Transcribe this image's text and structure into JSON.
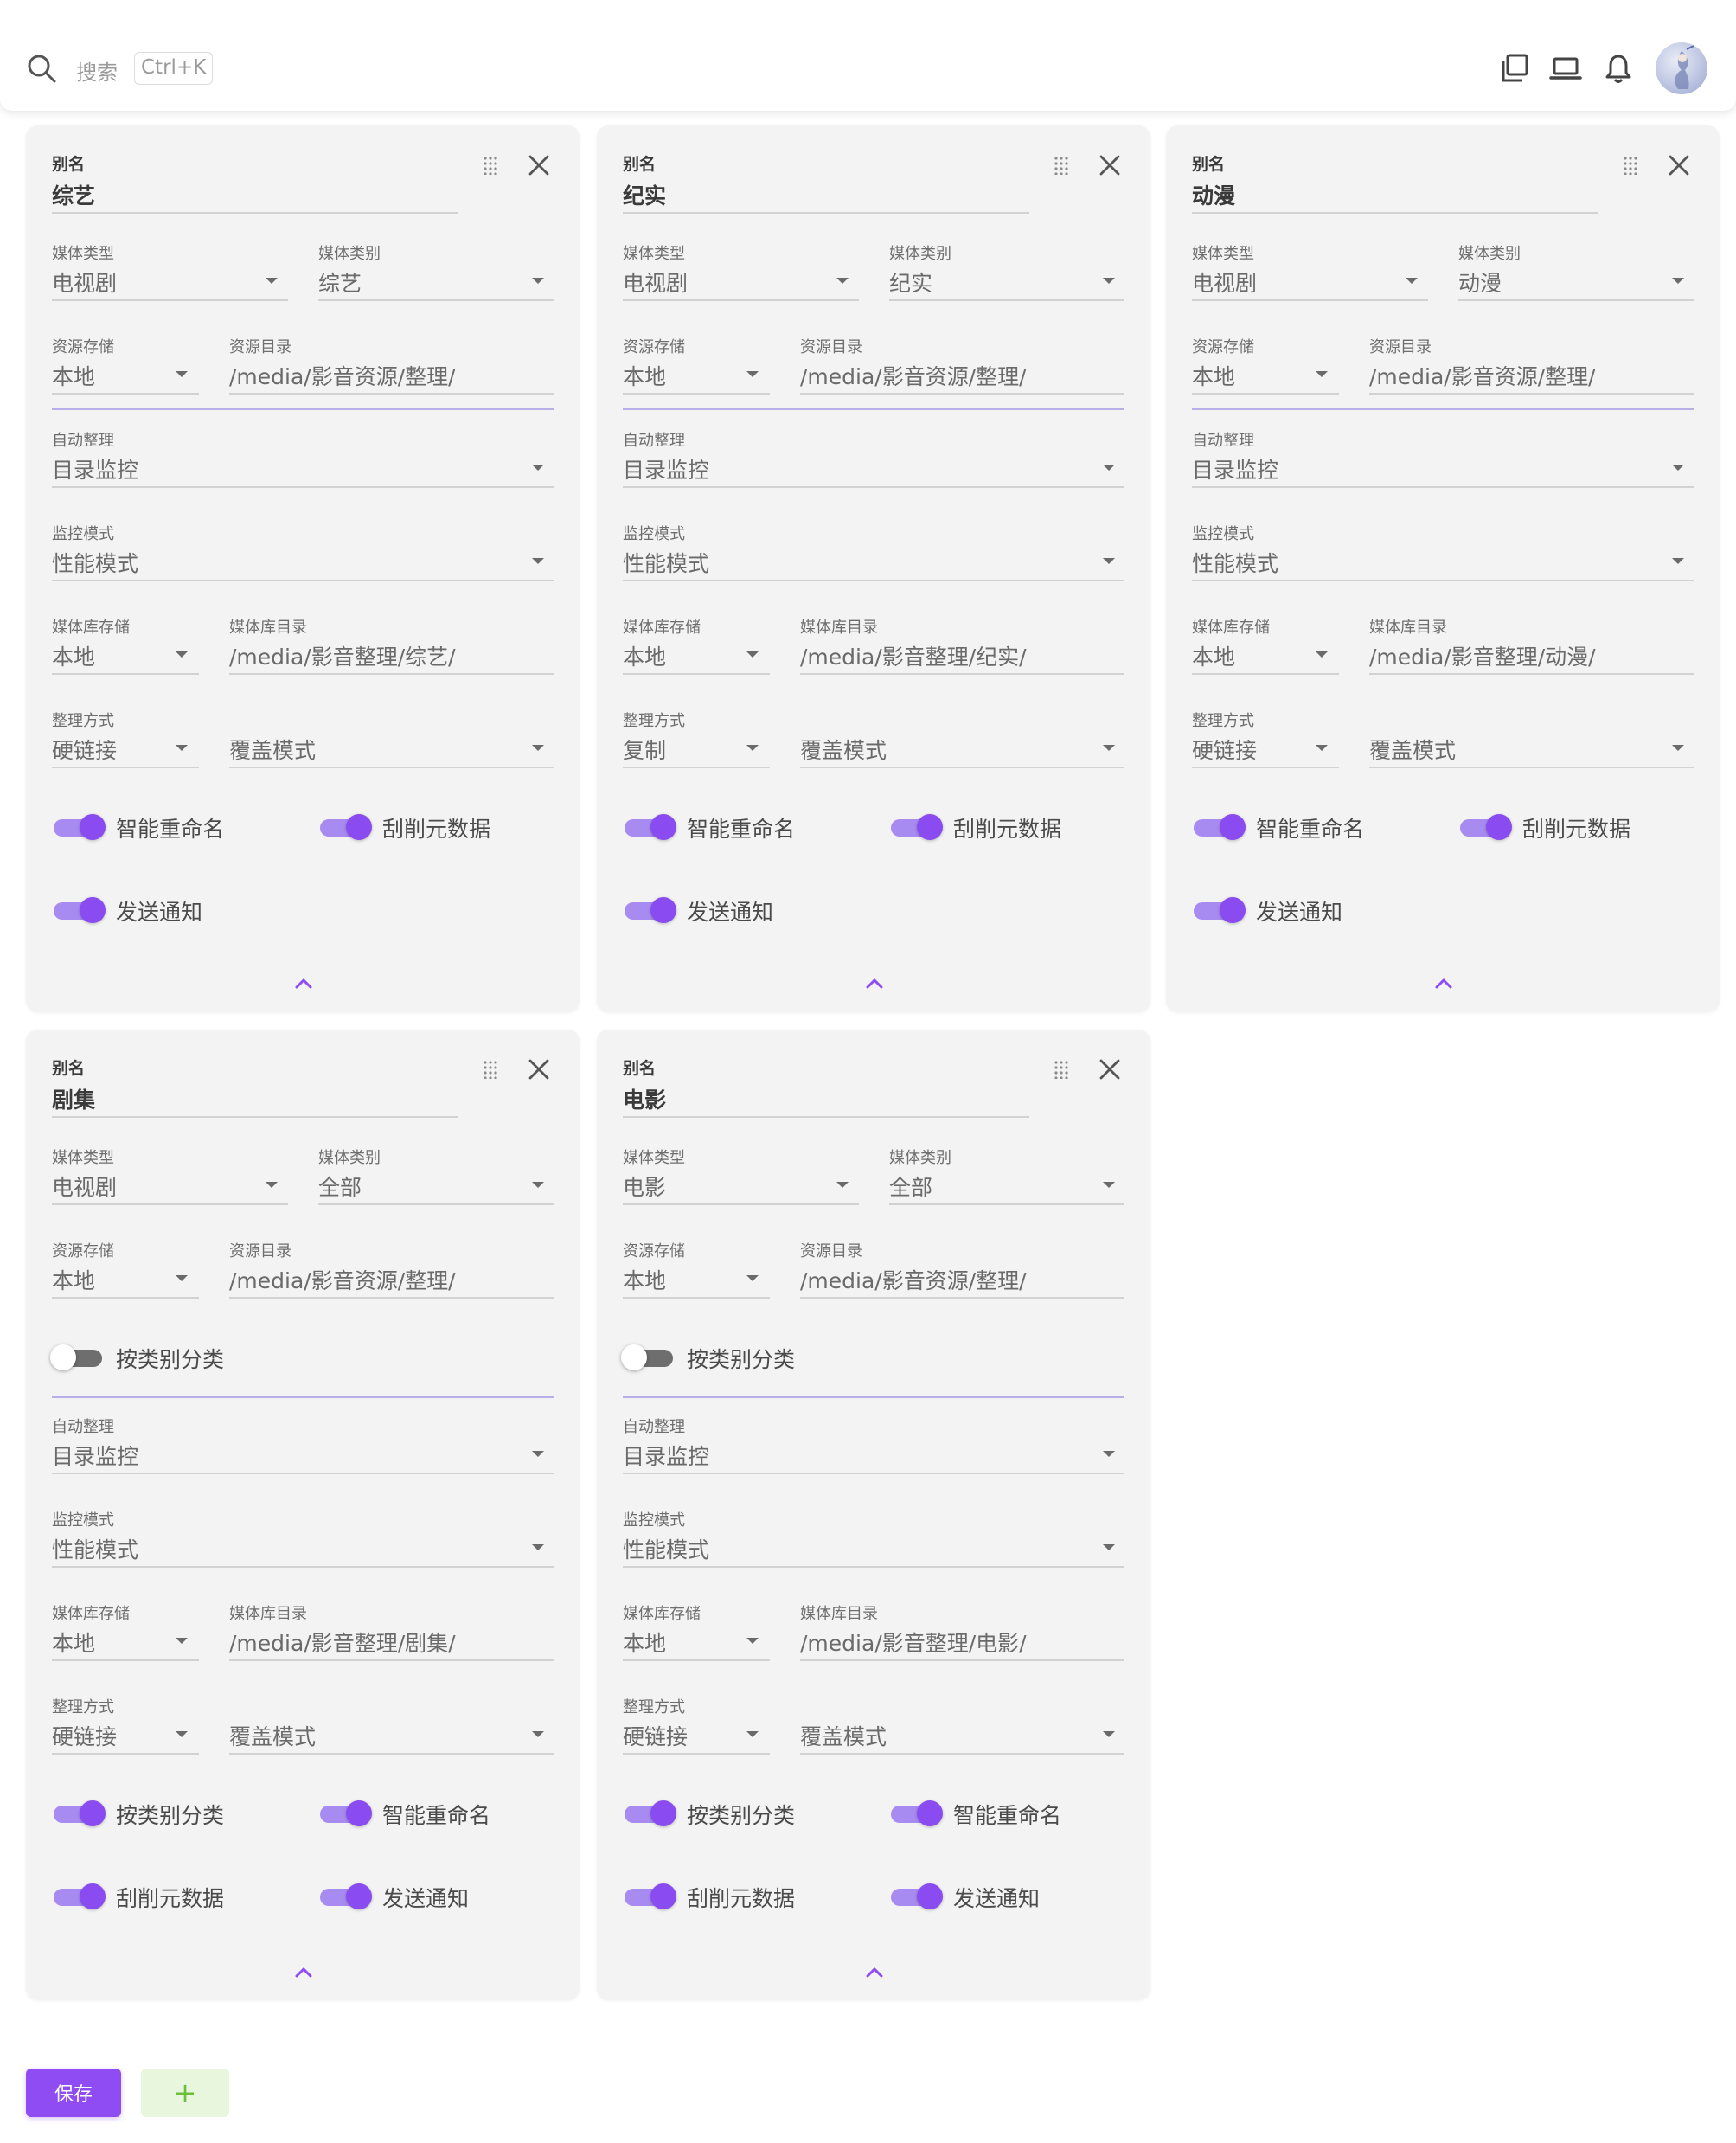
{
  "topbar": {
    "search_label": "搜索",
    "search_shortcut": "Ctrl+K"
  },
  "labels": {
    "alias": "别名",
    "media_type": "媒体类型",
    "media_category": "媒体类别",
    "source_storage": "资源存储",
    "source_dir": "资源目录",
    "auto_organize": "自动整理",
    "monitor_mode": "监控模式",
    "library_storage": "媒体库存储",
    "library_dir": "媒体库目录",
    "transfer_method": "整理方式"
  },
  "cards": [
    {
      "alias": "综艺",
      "media_type": "电视剧",
      "media_category": "综艺",
      "source_storage": "本地",
      "source_dir": "/media/影音资源/整理/",
      "auto_organize": "目录监控",
      "monitor_mode": "性能模式",
      "library_storage": "本地",
      "library_dir": "/media/影音整理/综艺/",
      "transfer_method": "硬链接",
      "overwrite_mode": "覆盖模式",
      "toggles": [
        {
          "label": "智能重命名",
          "on": true
        },
        {
          "label": "刮削元数据",
          "on": true
        },
        {
          "label": "发送通知",
          "on": true
        }
      ]
    },
    {
      "alias": "纪实",
      "media_type": "电视剧",
      "media_category": "纪实",
      "source_storage": "本地",
      "source_dir": "/media/影音资源/整理/",
      "auto_organize": "目录监控",
      "monitor_mode": "性能模式",
      "library_storage": "本地",
      "library_dir": "/media/影音整理/纪实/",
      "transfer_method": "复制",
      "overwrite_mode": "覆盖模式",
      "toggles": [
        {
          "label": "智能重命名",
          "on": true
        },
        {
          "label": "刮削元数据",
          "on": true
        },
        {
          "label": "发送通知",
          "on": true
        }
      ]
    },
    {
      "alias": "动漫",
      "media_type": "电视剧",
      "media_category": "动漫",
      "source_storage": "本地",
      "source_dir": "/media/影音资源/整理/",
      "auto_organize": "目录监控",
      "monitor_mode": "性能模式",
      "library_storage": "本地",
      "library_dir": "/media/影音整理/动漫/",
      "transfer_method": "硬链接",
      "overwrite_mode": "覆盖模式",
      "toggles": [
        {
          "label": "智能重命名",
          "on": true
        },
        {
          "label": "刮削元数据",
          "on": true
        },
        {
          "label": "发送通知",
          "on": true
        }
      ]
    },
    {
      "alias": "剧集",
      "media_type": "电视剧",
      "media_category": "全部",
      "source_storage": "本地",
      "source_dir": "/media/影音资源/整理/",
      "classify_toggle": {
        "label": "按类别分类",
        "on": false
      },
      "auto_organize": "目录监控",
      "monitor_mode": "性能模式",
      "library_storage": "本地",
      "library_dir": "/media/影音整理/剧集/",
      "transfer_method": "硬链接",
      "overwrite_mode": "覆盖模式",
      "toggles": [
        {
          "label": "按类别分类",
          "on": true
        },
        {
          "label": "智能重命名",
          "on": true
        },
        {
          "label": "刮削元数据",
          "on": true
        },
        {
          "label": "发送通知",
          "on": true
        }
      ]
    },
    {
      "alias": "电影",
      "media_type": "电影",
      "media_category": "全部",
      "source_storage": "本地",
      "source_dir": "/media/影音资源/整理/",
      "classify_toggle": {
        "label": "按类别分类",
        "on": false
      },
      "auto_organize": "目录监控",
      "monitor_mode": "性能模式",
      "library_storage": "本地",
      "library_dir": "/media/影音整理/电影/",
      "transfer_method": "硬链接",
      "overwrite_mode": "覆盖模式",
      "toggles": [
        {
          "label": "按类别分类",
          "on": true
        },
        {
          "label": "智能重命名",
          "on": true
        },
        {
          "label": "刮削元数据",
          "on": true
        },
        {
          "label": "发送通知",
          "on": true
        }
      ]
    }
  ],
  "actions": {
    "save_label": "保存",
    "add_label": "+"
  },
  "colors": {
    "accent": "#8f4cf2",
    "switch_track": "#a78bf0",
    "card_bg": "#f3f3f3",
    "add_button_bg": "#e9f6de"
  }
}
